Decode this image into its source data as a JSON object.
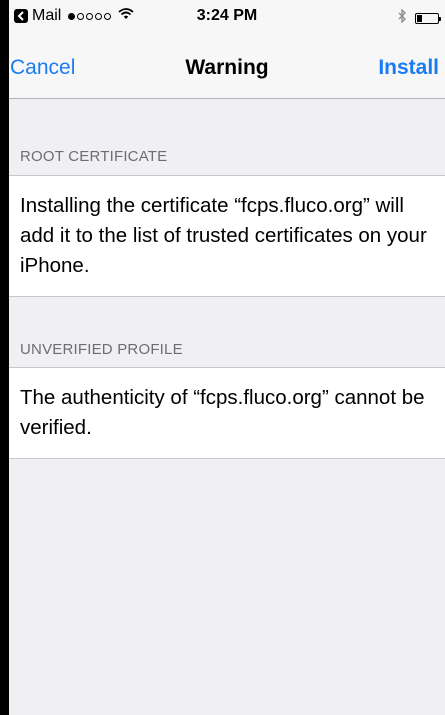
{
  "status": {
    "carrier": "Mail",
    "time": "3:24 PM",
    "signal_bars_filled": 1,
    "signal_bars_total": 5
  },
  "nav": {
    "cancel_label": "Cancel",
    "title": "Warning",
    "install_label": "Install"
  },
  "sections": [
    {
      "header": "ROOT CERTIFICATE",
      "body": "Installing the certificate “fcps.fluco.org” will add it to the list of trusted certificates on your iPhone."
    },
    {
      "header": "UNVERIFIED PROFILE",
      "body": "The authenticity of “fcps.fluco.org” cannot be verified."
    }
  ],
  "colors": {
    "accent": "#1a7cf5",
    "background": "#efeff4",
    "section_header": "#6d6d72"
  }
}
